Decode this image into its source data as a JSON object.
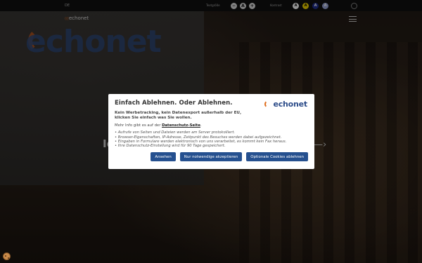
{
  "background": {
    "brand_wall": "echonet",
    "hero_text": "Io",
    "hero_arrow": "—›"
  },
  "topbar": {
    "language": "DE",
    "textsize_label": "Textgröße",
    "textsize_buttons": [
      "−",
      "A",
      "+"
    ],
    "contrast_label": "Kontrast",
    "contrast_buttons": [
      "A",
      "A",
      "A",
      "A"
    ]
  },
  "nav": {
    "logo": "echonet",
    "logo_mark": "((("
  },
  "modal": {
    "title": "Einfach Ablehnen. Oder Ablehnen.",
    "logo": "echonet",
    "lead_1": "Kein Werbetracking, kein Datenexport außerhalb der EU,",
    "lead_2": "klicken Sie einfach was Sie wollen.",
    "info_prefix": "Mehr Info gibt es auf der ",
    "info_link": "Datenschutz-Seite",
    "info_suffix": ".",
    "bullets": [
      "Aufrufe von Seiten und Dateien werden am Server protokolliert.",
      "Browser-Eigenschaften, IP-Adresse, Zeitpunkt des Besuches werden dabei aufgezeichnet.",
      "Eingaben in Formulare werden elektronisch von uns verarbeitet, es kommt kein Fax heraus.",
      "Ihre Datenschutz-Einstellung wird für 90 Tage gespeichert."
    ],
    "buttons": {
      "view": "Ansehen",
      "necessary": "Nur notwendige akzeptieren",
      "optional": "Optionale Cookies ablehnen"
    },
    "accent_color": "#25508f",
    "brand_orange": "#e07020"
  }
}
